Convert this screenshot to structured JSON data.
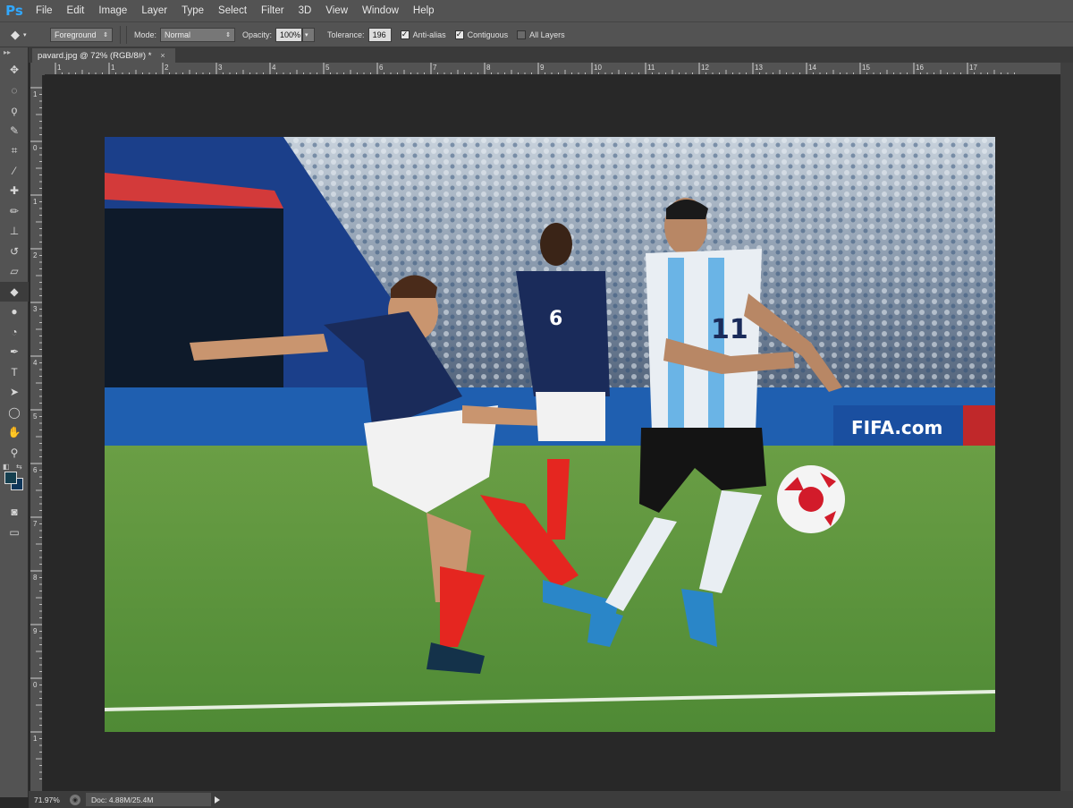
{
  "app": {
    "logo": "Ps"
  },
  "menu": [
    "File",
    "Edit",
    "Image",
    "Layer",
    "Type",
    "Select",
    "Filter",
    "3D",
    "View",
    "Window",
    "Help"
  ],
  "options": {
    "fill_source": "Foreground",
    "mode_label": "Mode:",
    "mode_value": "Normal",
    "opacity_label": "Opacity:",
    "opacity_value": "100%",
    "tolerance_label": "Tolerance:",
    "tolerance_value": "196",
    "anti_alias_label": "Anti-alias",
    "anti_alias_checked": true,
    "contiguous_label": "Contiguous",
    "contiguous_checked": true,
    "all_layers_label": "All Layers",
    "all_layers_checked": false
  },
  "document": {
    "tab_title": "pavard.jpg @ 72% (RGB/8#) *",
    "close_glyph": "×"
  },
  "ruler": {
    "h_labels": [
      "1",
      "1",
      "2",
      "3",
      "4",
      "5",
      "6",
      "7",
      "8",
      "9",
      "10",
      "11",
      "12",
      "13",
      "14",
      "15",
      "16",
      "17"
    ],
    "v_labels": [
      "1",
      "0",
      "1",
      "2",
      "3",
      "4",
      "5",
      "6",
      "7",
      "8",
      "9",
      "0",
      "1"
    ]
  },
  "tools": [
    {
      "name": "move-tool-icon",
      "glyph": "✥"
    },
    {
      "name": "marquee-tool-icon",
      "glyph": "◌"
    },
    {
      "name": "lasso-tool-icon",
      "glyph": "ϙ"
    },
    {
      "name": "quick-select-tool-icon",
      "glyph": "✎"
    },
    {
      "name": "crop-tool-icon",
      "glyph": "⌗"
    },
    {
      "name": "eyedropper-tool-icon",
      "glyph": "⁄"
    },
    {
      "name": "healing-brush-tool-icon",
      "glyph": "✚"
    },
    {
      "name": "brush-tool-icon",
      "glyph": "✏"
    },
    {
      "name": "clone-stamp-tool-icon",
      "glyph": "⊥"
    },
    {
      "name": "history-brush-tool-icon",
      "glyph": "↺"
    },
    {
      "name": "eraser-tool-icon",
      "glyph": "▱"
    },
    {
      "name": "paint-bucket-tool-icon",
      "glyph": "◆"
    },
    {
      "name": "blur-tool-icon",
      "glyph": "●"
    },
    {
      "name": "dodge-tool-icon",
      "glyph": "◔"
    },
    {
      "name": "pen-tool-icon",
      "glyph": "✒"
    },
    {
      "name": "type-tool-icon",
      "glyph": "T"
    },
    {
      "name": "path-select-tool-icon",
      "glyph": "➤"
    },
    {
      "name": "shape-tool-icon",
      "glyph": "◯"
    },
    {
      "name": "hand-tool-icon",
      "glyph": "✋"
    },
    {
      "name": "zoom-tool-icon",
      "glyph": "⚲"
    }
  ],
  "colors": {
    "foreground": "#153f4f",
    "background": "#0f365a",
    "accent": "#31a8ff"
  },
  "status": {
    "zoom": "71.97%",
    "doc": "Doc: 4.88M/25.4M"
  }
}
